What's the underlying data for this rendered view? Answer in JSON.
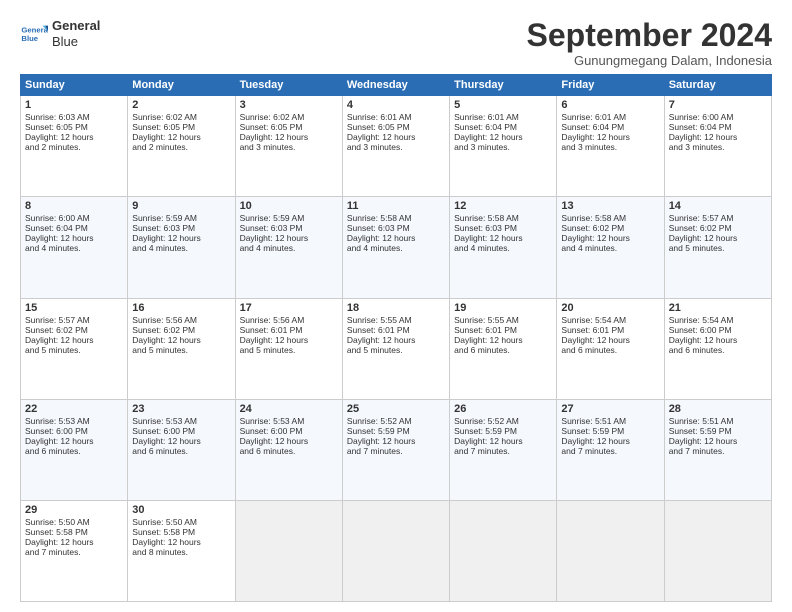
{
  "logo": {
    "line1": "General",
    "line2": "Blue"
  },
  "title": "September 2024",
  "subtitle": "Gunungmegang Dalam, Indonesia",
  "weekdays": [
    "Sunday",
    "Monday",
    "Tuesday",
    "Wednesday",
    "Thursday",
    "Friday",
    "Saturday"
  ],
  "weeks": [
    [
      {
        "day": "1",
        "lines": [
          "Sunrise: 6:03 AM",
          "Sunset: 6:05 PM",
          "Daylight: 12 hours",
          "and 2 minutes."
        ]
      },
      {
        "day": "2",
        "lines": [
          "Sunrise: 6:02 AM",
          "Sunset: 6:05 PM",
          "Daylight: 12 hours",
          "and 2 minutes."
        ]
      },
      {
        "day": "3",
        "lines": [
          "Sunrise: 6:02 AM",
          "Sunset: 6:05 PM",
          "Daylight: 12 hours",
          "and 3 minutes."
        ]
      },
      {
        "day": "4",
        "lines": [
          "Sunrise: 6:01 AM",
          "Sunset: 6:05 PM",
          "Daylight: 12 hours",
          "and 3 minutes."
        ]
      },
      {
        "day": "5",
        "lines": [
          "Sunrise: 6:01 AM",
          "Sunset: 6:04 PM",
          "Daylight: 12 hours",
          "and 3 minutes."
        ]
      },
      {
        "day": "6",
        "lines": [
          "Sunrise: 6:01 AM",
          "Sunset: 6:04 PM",
          "Daylight: 12 hours",
          "and 3 minutes."
        ]
      },
      {
        "day": "7",
        "lines": [
          "Sunrise: 6:00 AM",
          "Sunset: 6:04 PM",
          "Daylight: 12 hours",
          "and 3 minutes."
        ]
      }
    ],
    [
      {
        "day": "8",
        "lines": [
          "Sunrise: 6:00 AM",
          "Sunset: 6:04 PM",
          "Daylight: 12 hours",
          "and 4 minutes."
        ]
      },
      {
        "day": "9",
        "lines": [
          "Sunrise: 5:59 AM",
          "Sunset: 6:03 PM",
          "Daylight: 12 hours",
          "and 4 minutes."
        ]
      },
      {
        "day": "10",
        "lines": [
          "Sunrise: 5:59 AM",
          "Sunset: 6:03 PM",
          "Daylight: 12 hours",
          "and 4 minutes."
        ]
      },
      {
        "day": "11",
        "lines": [
          "Sunrise: 5:58 AM",
          "Sunset: 6:03 PM",
          "Daylight: 12 hours",
          "and 4 minutes."
        ]
      },
      {
        "day": "12",
        "lines": [
          "Sunrise: 5:58 AM",
          "Sunset: 6:03 PM",
          "Daylight: 12 hours",
          "and 4 minutes."
        ]
      },
      {
        "day": "13",
        "lines": [
          "Sunrise: 5:58 AM",
          "Sunset: 6:02 PM",
          "Daylight: 12 hours",
          "and 4 minutes."
        ]
      },
      {
        "day": "14",
        "lines": [
          "Sunrise: 5:57 AM",
          "Sunset: 6:02 PM",
          "Daylight: 12 hours",
          "and 5 minutes."
        ]
      }
    ],
    [
      {
        "day": "15",
        "lines": [
          "Sunrise: 5:57 AM",
          "Sunset: 6:02 PM",
          "Daylight: 12 hours",
          "and 5 minutes."
        ]
      },
      {
        "day": "16",
        "lines": [
          "Sunrise: 5:56 AM",
          "Sunset: 6:02 PM",
          "Daylight: 12 hours",
          "and 5 minutes."
        ]
      },
      {
        "day": "17",
        "lines": [
          "Sunrise: 5:56 AM",
          "Sunset: 6:01 PM",
          "Daylight: 12 hours",
          "and 5 minutes."
        ]
      },
      {
        "day": "18",
        "lines": [
          "Sunrise: 5:55 AM",
          "Sunset: 6:01 PM",
          "Daylight: 12 hours",
          "and 5 minutes."
        ]
      },
      {
        "day": "19",
        "lines": [
          "Sunrise: 5:55 AM",
          "Sunset: 6:01 PM",
          "Daylight: 12 hours",
          "and 6 minutes."
        ]
      },
      {
        "day": "20",
        "lines": [
          "Sunrise: 5:54 AM",
          "Sunset: 6:01 PM",
          "Daylight: 12 hours",
          "and 6 minutes."
        ]
      },
      {
        "day": "21",
        "lines": [
          "Sunrise: 5:54 AM",
          "Sunset: 6:00 PM",
          "Daylight: 12 hours",
          "and 6 minutes."
        ]
      }
    ],
    [
      {
        "day": "22",
        "lines": [
          "Sunrise: 5:53 AM",
          "Sunset: 6:00 PM",
          "Daylight: 12 hours",
          "and 6 minutes."
        ]
      },
      {
        "day": "23",
        "lines": [
          "Sunrise: 5:53 AM",
          "Sunset: 6:00 PM",
          "Daylight: 12 hours",
          "and 6 minutes."
        ]
      },
      {
        "day": "24",
        "lines": [
          "Sunrise: 5:53 AM",
          "Sunset: 6:00 PM",
          "Daylight: 12 hours",
          "and 6 minutes."
        ]
      },
      {
        "day": "25",
        "lines": [
          "Sunrise: 5:52 AM",
          "Sunset: 5:59 PM",
          "Daylight: 12 hours",
          "and 7 minutes."
        ]
      },
      {
        "day": "26",
        "lines": [
          "Sunrise: 5:52 AM",
          "Sunset: 5:59 PM",
          "Daylight: 12 hours",
          "and 7 minutes."
        ]
      },
      {
        "day": "27",
        "lines": [
          "Sunrise: 5:51 AM",
          "Sunset: 5:59 PM",
          "Daylight: 12 hours",
          "and 7 minutes."
        ]
      },
      {
        "day": "28",
        "lines": [
          "Sunrise: 5:51 AM",
          "Sunset: 5:59 PM",
          "Daylight: 12 hours",
          "and 7 minutes."
        ]
      }
    ],
    [
      {
        "day": "29",
        "lines": [
          "Sunrise: 5:50 AM",
          "Sunset: 5:58 PM",
          "Daylight: 12 hours",
          "and 7 minutes."
        ]
      },
      {
        "day": "30",
        "lines": [
          "Sunrise: 5:50 AM",
          "Sunset: 5:58 PM",
          "Daylight: 12 hours",
          "and 8 minutes."
        ]
      },
      null,
      null,
      null,
      null,
      null
    ]
  ]
}
